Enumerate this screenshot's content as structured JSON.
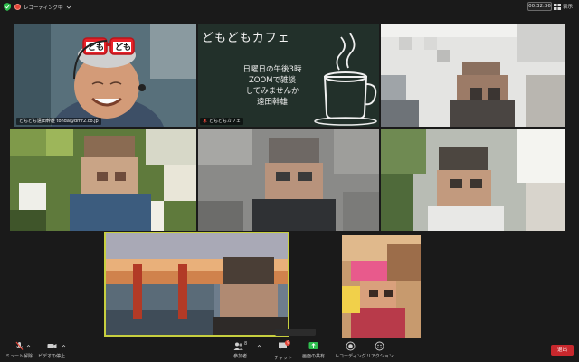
{
  "topbar": {
    "recording_label": "レコーディング中",
    "timer": "00:32:36",
    "view_label": "表示"
  },
  "tiles": [
    {
      "id": "t1",
      "name": "どもども遠田幹雄 tohda@dmr2.co.jp"
    },
    {
      "id": "t2",
      "name": "どもどもカフェ"
    }
  ],
  "chalkboard": {
    "title": "どもどもカフェ",
    "lines": [
      "日曜日の午後3時",
      "ZOOMで雑談",
      "してみませんか",
      "遠田幹雄"
    ]
  },
  "glasses_text": {
    "left": "ども",
    "right": "ども"
  },
  "toolbar": {
    "mute_label": "ミュート解除",
    "video_label": "ビデオの停止",
    "participants_label": "参加者",
    "participants_count": "8",
    "chat_label": "チャット",
    "chat_badge": "9",
    "share_label": "画面の共有",
    "record_label": "レコーディング",
    "reaction_label": "リアクション",
    "leave_label": "退出"
  },
  "colors": {
    "leave": "#c8282d",
    "share": "#2fbf4f",
    "active_speaker": "#c7cf3f"
  }
}
